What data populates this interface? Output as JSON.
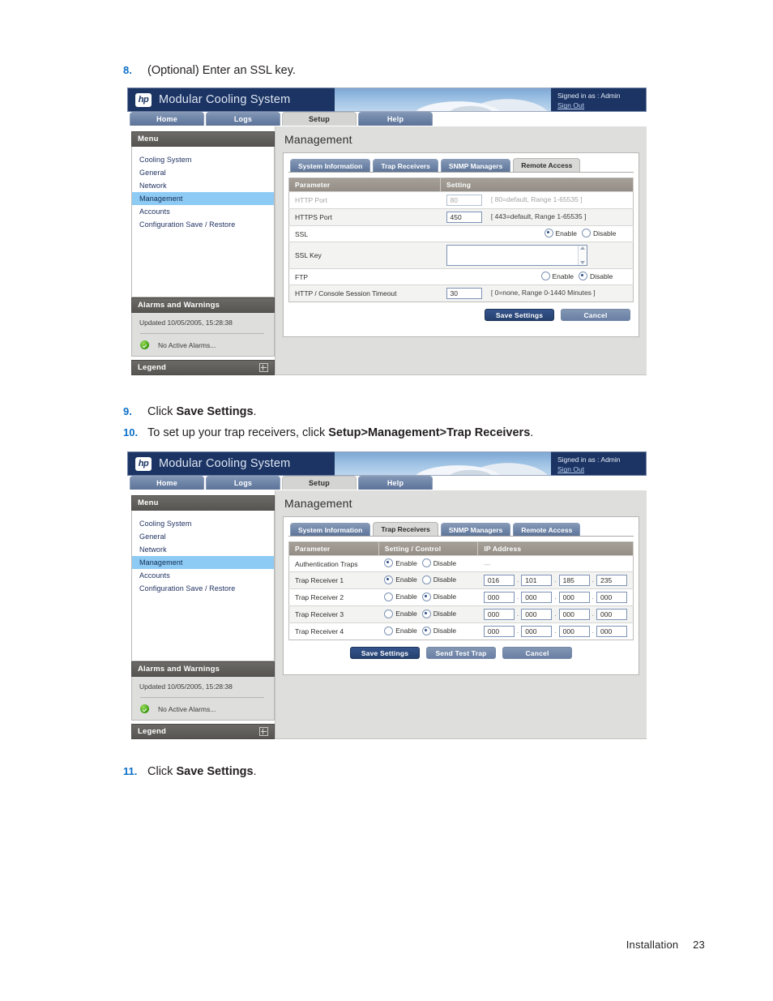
{
  "steps": [
    {
      "num": "8.",
      "pre": "(Optional) Enter an SSL key.",
      "bold": "",
      "post": ""
    },
    {
      "num": "9.",
      "pre": "Click ",
      "bold": "Save Settings",
      "post": "."
    },
    {
      "num": "10.",
      "pre": "To set up your trap receivers, click ",
      "bold": "Setup>Management>Trap Receivers",
      "post": "."
    },
    {
      "num": "11.",
      "pre": "Click ",
      "bold": "Save Settings",
      "post": "."
    }
  ],
  "footer": {
    "section": "Installation",
    "page": "23"
  },
  "app": {
    "logo_text": "hp",
    "title": "Modular Cooling System",
    "signed_in": "Signed in as : Admin",
    "sign_out": "Sign Out",
    "nav_tabs": [
      {
        "label": "Home",
        "active": false
      },
      {
        "label": "Logs",
        "active": false
      },
      {
        "label": "Setup",
        "active": true
      },
      {
        "label": "Help",
        "active": false
      }
    ],
    "menu": {
      "header": "Menu",
      "items": [
        {
          "label": "Cooling System",
          "selected": false
        },
        {
          "label": "General",
          "selected": false
        },
        {
          "label": "Network",
          "selected": false
        },
        {
          "label": "Management",
          "selected": true
        },
        {
          "label": "Accounts",
          "selected": false
        },
        {
          "label": "Configuration Save / Restore",
          "selected": false
        }
      ]
    },
    "alarms": {
      "header": "Alarms and Warnings",
      "updated": "Updated 10/05/2005, 15:28:38",
      "status": "No Active Alarms..."
    },
    "legend": {
      "header": "Legend"
    },
    "page_title": "Management",
    "sub_tabs": [
      {
        "label": "System Information"
      },
      {
        "label": "Trap Receivers"
      },
      {
        "label": "SNMP Managers"
      },
      {
        "label": "Remote Access"
      }
    ]
  },
  "remote_access": {
    "active_tab": "Remote Access",
    "columns": [
      "Parameter",
      "Setting"
    ],
    "rows": [
      {
        "param": "HTTP Port",
        "type": "text",
        "value": "80",
        "hint": "[ 80=default, Range 1-65535 ]",
        "disabled": true
      },
      {
        "param": "HTTPS Port",
        "type": "text",
        "value": "450",
        "hint": "[ 443=default, Range 1-65535 ]",
        "disabled": false
      },
      {
        "param": "SSL",
        "type": "radio",
        "options": [
          "Enable",
          "Disable"
        ],
        "selected": "Enable"
      },
      {
        "param": "SSL Key",
        "type": "textarea",
        "value": ""
      },
      {
        "param": "FTP",
        "type": "radio",
        "options": [
          "Enable",
          "Disable"
        ],
        "selected": "Disable"
      },
      {
        "param": "HTTP / Console Session Timeout",
        "type": "text",
        "value": "30",
        "hint": "[ 0=none, Range 0-1440 Minutes ]",
        "disabled": false
      }
    ],
    "buttons": [
      {
        "label": "Save Settings",
        "style": "primary"
      },
      {
        "label": "Cancel",
        "style": "secondary"
      }
    ]
  },
  "trap_receivers": {
    "active_tab": "Trap Receivers",
    "columns": [
      "Parameter",
      "Setting / Control",
      "IP Address"
    ],
    "rows": [
      {
        "param": "Authentication Traps",
        "options": [
          "Enable",
          "Disable"
        ],
        "selected": "Enable",
        "ip": null,
        "ip_placeholder": "---"
      },
      {
        "param": "Trap Receiver 1",
        "options": [
          "Enable",
          "Disable"
        ],
        "selected": "Enable",
        "ip": [
          "016",
          "101",
          "185",
          "235"
        ]
      },
      {
        "param": "Trap Receiver 2",
        "options": [
          "Enable",
          "Disable"
        ],
        "selected": "Disable",
        "ip": [
          "000",
          "000",
          "000",
          "000"
        ]
      },
      {
        "param": "Trap Receiver 3",
        "options": [
          "Enable",
          "Disable"
        ],
        "selected": "Disable",
        "ip": [
          "000",
          "000",
          "000",
          "000"
        ]
      },
      {
        "param": "Trap Receiver 4",
        "options": [
          "Enable",
          "Disable"
        ],
        "selected": "Disable",
        "ip": [
          "000",
          "000",
          "000",
          "000"
        ]
      }
    ],
    "buttons": [
      {
        "label": "Save Settings",
        "style": "primary"
      },
      {
        "label": "Send Test Trap",
        "style": "secondary"
      },
      {
        "label": "Cancel",
        "style": "secondary"
      }
    ]
  }
}
